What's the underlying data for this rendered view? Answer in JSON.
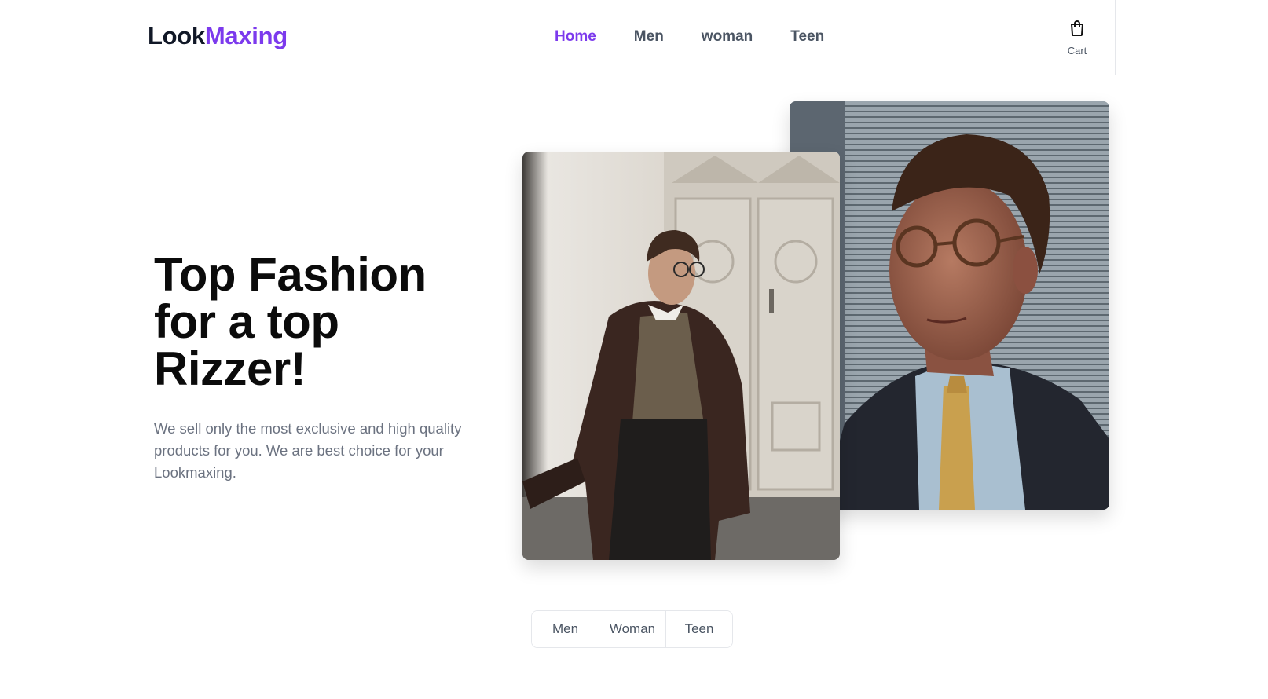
{
  "header": {
    "logo_primary": "Look",
    "logo_accent": "Maxing",
    "nav": [
      {
        "label": "Home",
        "active": true
      },
      {
        "label": "Men"
      },
      {
        "label": "woman"
      },
      {
        "label": "Teen"
      }
    ],
    "cart_label": "Cart"
  },
  "hero": {
    "title_line1": "Top Fashion",
    "title_line2": "for a top",
    "title_line3": "Rizzer!",
    "description": "We sell only the most exclusive and high quality products for you. We are best choice for your Lookmaxing."
  },
  "filters": [
    "Men",
    "Woman",
    "Teen"
  ],
  "colors": {
    "accent": "#7c3aed",
    "text_muted": "#6b7280",
    "border": "#e5e7eb"
  },
  "icons": {
    "cart": "shopping-bag-icon"
  }
}
